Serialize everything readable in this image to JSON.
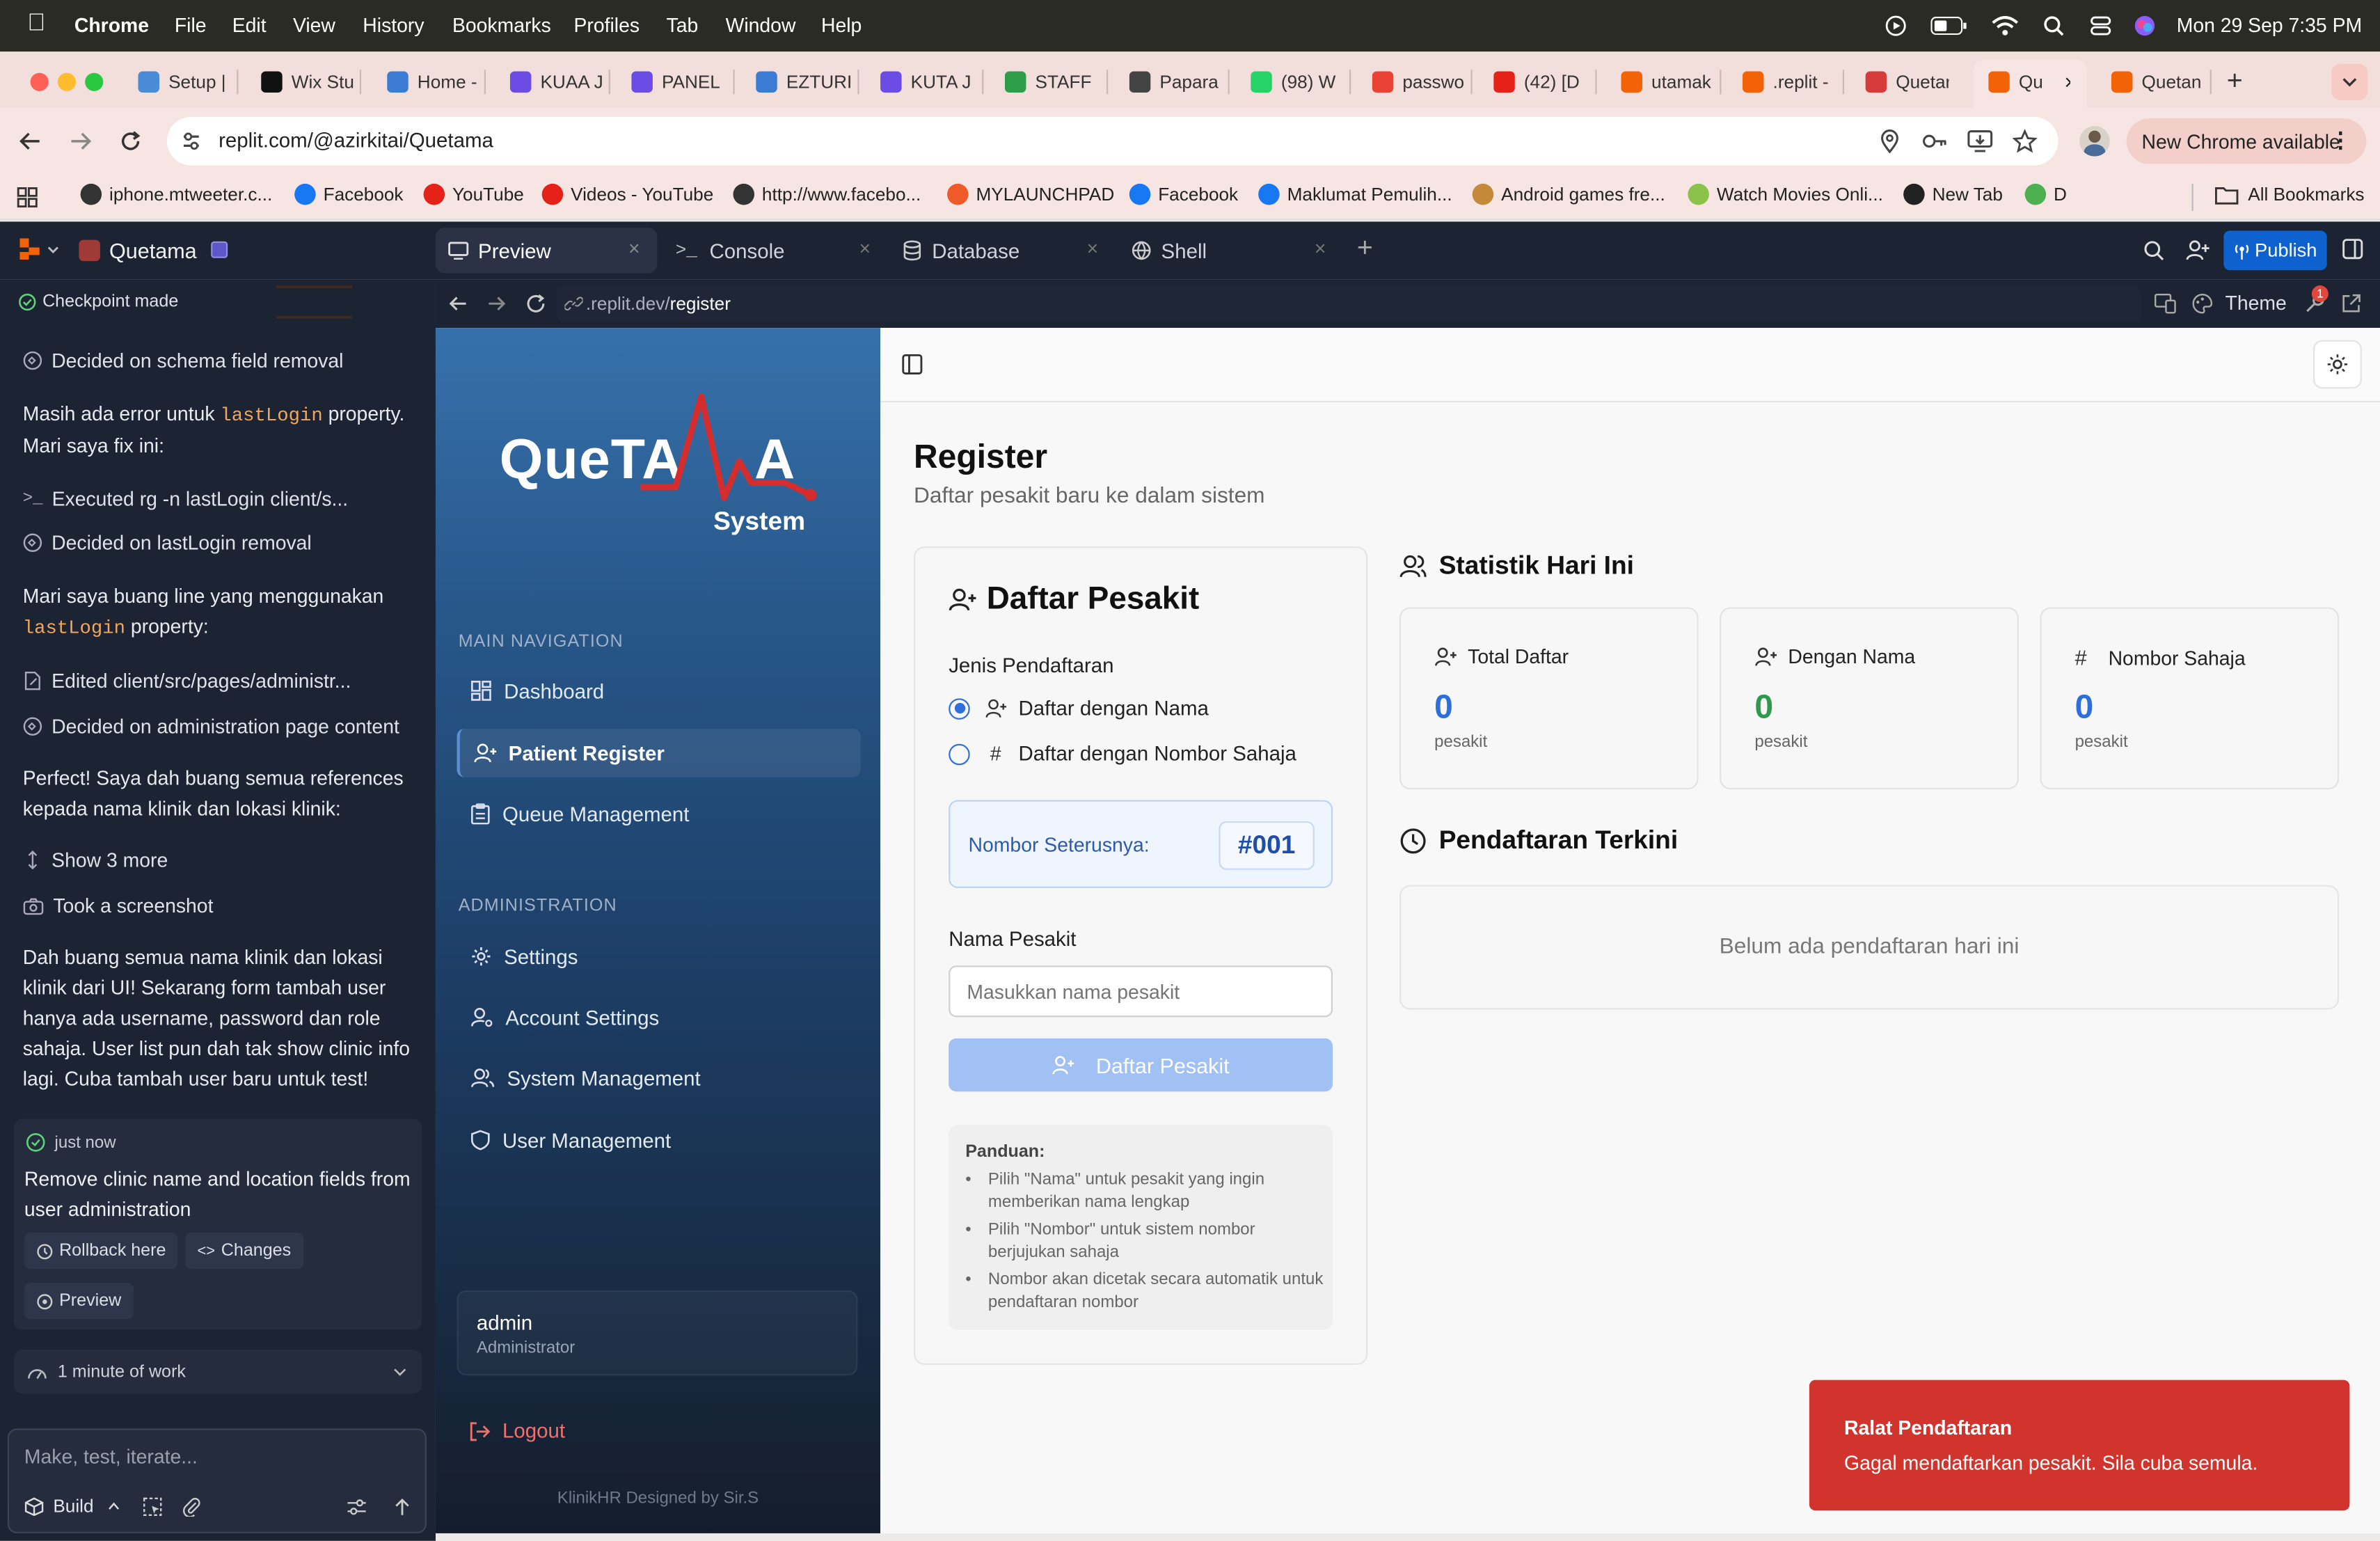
{
  "menubar": {
    "app": "Chrome",
    "items": [
      "File",
      "Edit",
      "View",
      "History",
      "Bookmarks",
      "Profiles",
      "Tab",
      "Window",
      "Help"
    ],
    "datetime": "Mon 29 Sep  7:35 PM"
  },
  "tabs": [
    {
      "label": "Setup |",
      "color": "#4a8bd8"
    },
    {
      "label": "Wix Stu",
      "color": "#111111"
    },
    {
      "label": "Home -",
      "color": "#3b7bd4"
    },
    {
      "label": "KUAA J",
      "color": "#6b4de6"
    },
    {
      "label": "PANEL",
      "color": "#6b4de6"
    },
    {
      "label": "EZTURI",
      "color": "#3b7bd4"
    },
    {
      "label": "KUTA J",
      "color": "#6b4de6"
    },
    {
      "label": "STAFF",
      "color": "#2e9d4a"
    },
    {
      "label": "Papara",
      "color": "#444444"
    },
    {
      "label": "(98) W",
      "color": "#25d366"
    },
    {
      "label": "passwo",
      "color": "#ea4335"
    },
    {
      "label": "(42) [D",
      "color": "#e62117"
    },
    {
      "label": "utamak",
      "color": "#f26207"
    },
    {
      "label": ".replit -",
      "color": "#f26207"
    },
    {
      "label": "Quetan",
      "color": "#d83b3b"
    },
    {
      "label": "Qu",
      "color": "#f26207"
    },
    {
      "label": "Quetan",
      "color": "#f26207"
    }
  ],
  "url": "replit.com/@azirkitai/Quetama",
  "new_chrome": "New Chrome available",
  "bookmarks": [
    {
      "label": "iphone.mtweeter.c...",
      "color": "#333333"
    },
    {
      "label": "Facebook",
      "color": "#1877f2"
    },
    {
      "label": "YouTube",
      "color": "#e62117"
    },
    {
      "label": "Videos - YouTube",
      "color": "#e62117"
    },
    {
      "label": "http://www.facebo...",
      "color": "#333333"
    },
    {
      "label": "MYLAUNCHPAD",
      "color": "#f05a28"
    },
    {
      "label": "Facebook",
      "color": "#1877f2"
    },
    {
      "label": "Maklumat Pemulih...",
      "color": "#1877f2"
    },
    {
      "label": "Android games fre...",
      "color": "#c48a3a"
    },
    {
      "label": "Watch Movies Onli...",
      "color": "#8bc34a"
    },
    {
      "label": "New Tab",
      "color": "#222222"
    },
    {
      "label": "D",
      "color": "#4caf50"
    }
  ],
  "all_bookmarks": "All Bookmarks",
  "replit": {
    "project": "Quetama",
    "tabs": [
      "Preview",
      "Console",
      "Database",
      "Shell"
    ],
    "publish": "Publish",
    "preview_url_prefix": ".replit.dev/",
    "preview_url_path": "register",
    "theme": "Theme",
    "badge": "1"
  },
  "agent": {
    "checkpoint": "Checkpoint made",
    "step1": "Decided on schema field removal",
    "msg1_a": "Masih ada error untuk ",
    "msg1_code": "lastLogin",
    "msg1_b": " property. Mari saya fix ini:",
    "step2": "Executed rg -n lastLogin client/s...",
    "step3": "Decided on lastLogin removal",
    "msg2_a": "Mari saya buang line yang menggunakan ",
    "msg2_code": "lastLogin",
    "msg2_b": " property:",
    "step4": "Edited client/src/pages/administr...",
    "step5": "Decided on administration page content",
    "msg3": "Perfect! Saya dah buang semua references kepada nama klinik dan lokasi klinik:",
    "show_more": "Show 3 more",
    "screenshot": "Took a screenshot",
    "msg4": "Dah buang semua nama klinik dan lokasi klinik dari UI! Sekarang form tambah user hanya ada username, password dan role sahaja. User list pun dah tak show clinic info lagi. Cuba tambah user baru untuk test!",
    "time": "just now",
    "checkpoint_msg": "Remove clinic name and location fields from user administration",
    "rollback": "Rollback here",
    "changes": "Changes",
    "preview": "Preview",
    "work": "1 minute of work",
    "input_placeholder": "Make, test, iterate...",
    "build": "Build"
  },
  "app": {
    "logo_main": "QueTA",
    "logo_end": "A",
    "logo_sub": "System",
    "nav_section1": "MAIN NAVIGATION",
    "nav1": [
      "Dashboard",
      "Patient Register",
      "Queue Management"
    ],
    "nav_section2": "ADMINISTRATION",
    "nav2": [
      "Settings",
      "Account Settings",
      "System Management",
      "User Management"
    ],
    "user_name": "admin",
    "user_role": "Administrator",
    "logout": "Logout",
    "footer": "KlinikHR Designed by Sir.S",
    "page_title": "Register",
    "page_subtitle": "Daftar pesakit baru ke dalam sistem",
    "form_title": "Daftar Pesakit",
    "reg_type_label": "Jenis Pendaftaran",
    "radio1": "Daftar dengan Nama",
    "radio2": "Daftar dengan Nombor Sahaja",
    "next_label": "Nombor Seterusnya:",
    "next_value": "#001",
    "name_label": "Nama Pesakit",
    "name_placeholder": "Masukkan nama pesakit",
    "submit": "Daftar Pesakit",
    "guide_title": "Panduan:",
    "guide": [
      "Pilih \"Nama\" untuk pesakit yang ingin memberikan nama lengkap",
      "Pilih \"Nombor\" untuk sistem nombor berjujukan sahaja",
      "Nombor akan dicetak secara automatik untuk pendaftaran nombor"
    ],
    "stats_title": "Statistik Hari Ini",
    "stats": [
      {
        "label": "Total Daftar",
        "value": "0",
        "unit": "pesakit",
        "color": "#2f6fdc"
      },
      {
        "label": "Dengan Nama",
        "value": "0",
        "unit": "pesakit",
        "color": "#2e9a4c"
      },
      {
        "label": "Nombor Sahaja",
        "value": "0",
        "unit": "pesakit",
        "color": "#2f6fdc"
      }
    ],
    "recent_title": "Pendaftaran Terkini",
    "recent_empty": "Belum ada pendaftaran hari ini",
    "toast_title": "Ralat Pendaftaran",
    "toast_msg": "Gagal mendaftarkan pesakit. Sila cuba semula."
  }
}
